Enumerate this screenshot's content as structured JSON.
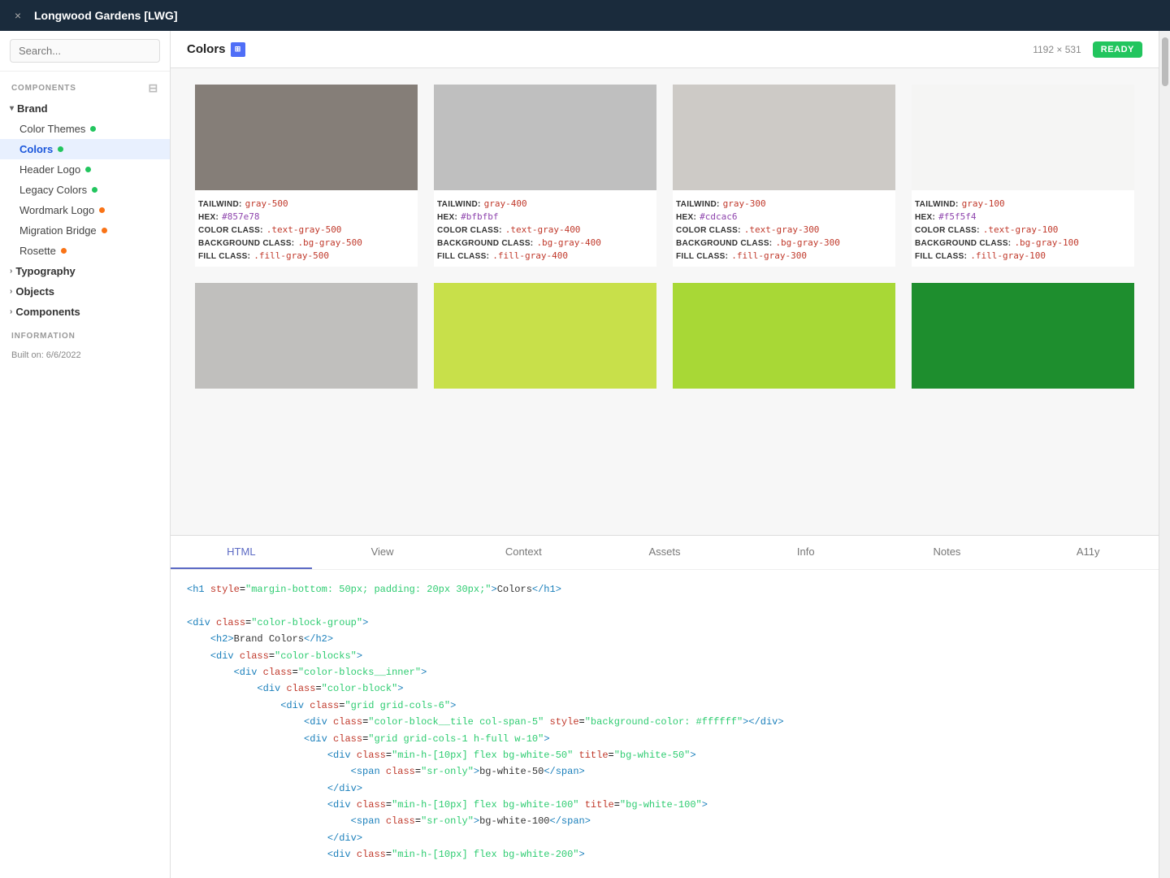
{
  "titlebar": {
    "close_label": "×",
    "title": "Longwood Gardens [LWG]"
  },
  "sidebar": {
    "search_placeholder": "Search...",
    "components_label": "COMPONENTS",
    "groups": [
      {
        "name": "Brand",
        "expanded": true,
        "items": [
          {
            "label": "Color Themes",
            "dot": "green",
            "active": false
          },
          {
            "label": "Colors",
            "dot": "green",
            "active": true
          },
          {
            "label": "Header Logo",
            "dot": "green",
            "active": false
          },
          {
            "label": "Legacy Colors",
            "dot": "green",
            "active": false
          },
          {
            "label": "Wordmark Logo",
            "dot": "orange",
            "active": false
          },
          {
            "label": "Migration Bridge",
            "dot": "orange",
            "active": false
          },
          {
            "label": "Rosette",
            "dot": "orange",
            "active": false
          }
        ]
      },
      {
        "name": "Typography",
        "expanded": false,
        "items": []
      },
      {
        "name": "Objects",
        "expanded": false,
        "items": []
      },
      {
        "name": "Components",
        "expanded": false,
        "items": []
      }
    ],
    "info_label": "INFORMATION",
    "built_on": "Built on: 6/6/2022"
  },
  "topbar": {
    "page_title": "Colors",
    "dimensions": "1192 × 531",
    "ready_label": "READY"
  },
  "color_cards_row1": [
    {
      "swatch_color": "#857e78",
      "tailwind": "gray-500",
      "hex": "#857e78",
      "color_class": ".text-gray-500",
      "bg_class": ".bg-gray-500",
      "fill_class": ".fill-gray-500"
    },
    {
      "swatch_color": "#bfbfbf",
      "tailwind": "gray-400",
      "hex": "#bfbfbf",
      "color_class": ".text-gray-400",
      "bg_class": ".bg-gray-400",
      "fill_class": ".fill-gray-400"
    },
    {
      "swatch_color": "#cdcac6",
      "tailwind": "gray-300",
      "hex": "#cdcac6",
      "color_class": ".text-gray-300",
      "bg_class": ".bg-gray-300",
      "fill_class": ".fill-gray-300"
    },
    {
      "swatch_color": "#f5f5f4",
      "tailwind": "gray-100",
      "hex": "#f5f5f4",
      "color_class": ".text-gray-100",
      "bg_class": ".bg-gray-100",
      "fill_class": ".fill-gray-100"
    }
  ],
  "color_cards_row2": [
    {
      "swatch_color": "#c0bfbd",
      "tailwind": "",
      "hex": "",
      "color_class": "",
      "bg_class": "",
      "fill_class": ""
    },
    {
      "swatch_color": "#c8e04a",
      "tailwind": "",
      "hex": "",
      "color_class": "",
      "bg_class": "",
      "fill_class": ""
    },
    {
      "swatch_color": "#a8d836",
      "tailwind": "",
      "hex": "",
      "color_class": "",
      "bg_class": "",
      "fill_class": ""
    },
    {
      "swatch_color": "#1e8e2e",
      "tailwind": "",
      "hex": "",
      "color_class": "",
      "bg_class": "",
      "fill_class": ""
    }
  ],
  "tabs": [
    {
      "label": "HTML",
      "active": true
    },
    {
      "label": "View",
      "active": false
    },
    {
      "label": "Context",
      "active": false
    },
    {
      "label": "Assets",
      "active": false
    },
    {
      "label": "Info",
      "active": false
    },
    {
      "label": "Notes",
      "active": false
    },
    {
      "label": "A11y",
      "active": false
    }
  ],
  "code": {
    "lines": [
      {
        "indent": 0,
        "html": "<h1_style_colors>"
      },
      {
        "indent": 0,
        "html": ""
      },
      {
        "indent": 0,
        "html": "<div_color-block-group>"
      },
      {
        "indent": 1,
        "html": "<h2>Brand Colors</h2>"
      },
      {
        "indent": 1,
        "html": "<div_color-blocks>"
      },
      {
        "indent": 2,
        "html": "<div_color-blocks__inner>"
      },
      {
        "indent": 3,
        "html": "<div_color-block>"
      },
      {
        "indent": 4,
        "html": "<div_grid-cols-6>"
      },
      {
        "indent": 5,
        "html": "<div_color-block__tile_col-span-5_bg-ffffff>"
      },
      {
        "indent": 5,
        "html": "<div_grid-grid-cols-1-h-full-w-10>"
      },
      {
        "indent": 6,
        "html": "<div_min-h-10px-flex-bg-white-50_bg-white-50>"
      },
      {
        "indent": 7,
        "html": "<span_sr-only>bg-white-50</span>"
      },
      {
        "indent": 6,
        "html": "</div>"
      },
      {
        "indent": 6,
        "html": "<div_min-h-10px-flex-bg-white-100_bg-white-100>"
      },
      {
        "indent": 7,
        "html": "<span_sr-only>bg-white-100</span>"
      },
      {
        "indent": 6,
        "html": "</div>"
      },
      {
        "indent": 6,
        "html": "<div_min-h-10px-flex-bg-white-200>"
      }
    ]
  }
}
